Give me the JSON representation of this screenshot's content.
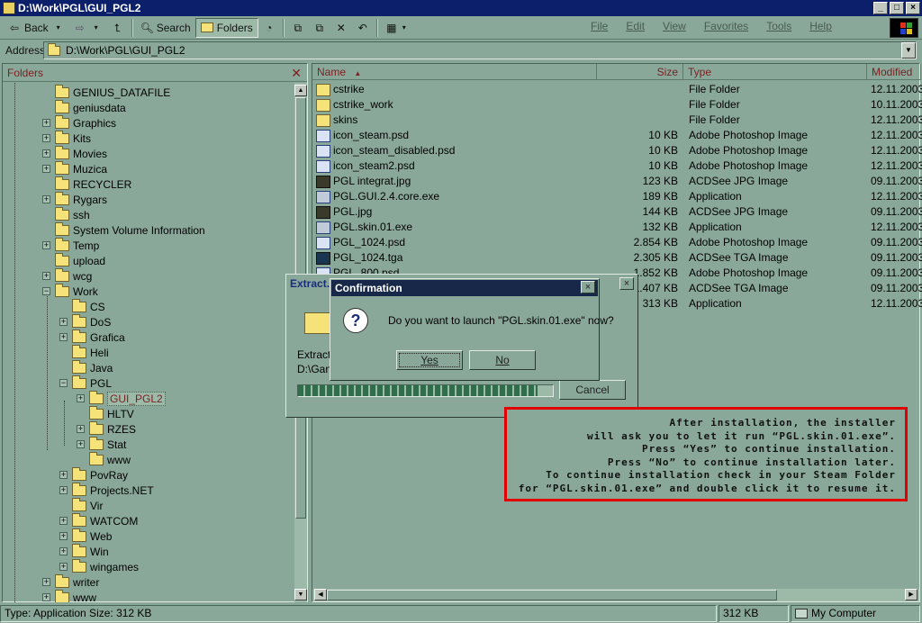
{
  "window": {
    "title": "D:\\Work\\PGL\\GUI_PGL2",
    "btn_min": "_",
    "btn_max": "□",
    "btn_close": "×"
  },
  "toolbar": {
    "back": "Back",
    "search": "Search",
    "folders": "Folders"
  },
  "menu": [
    "File",
    "Edit",
    "View",
    "Favorites",
    "Tools",
    "Help"
  ],
  "address": {
    "label": "Address",
    "value": "D:\\Work\\PGL\\GUI_PGL2"
  },
  "folders_pane": {
    "title": "Folders",
    "items": [
      {
        "label": "GENIUS_DATAFILE",
        "expander": ""
      },
      {
        "label": "geniusdata",
        "expander": ""
      },
      {
        "label": "Graphics",
        "expander": "+"
      },
      {
        "label": "Kits",
        "expander": "+"
      },
      {
        "label": "Movies",
        "expander": "+"
      },
      {
        "label": "Muzica",
        "expander": "+"
      },
      {
        "label": "RECYCLER",
        "expander": ""
      },
      {
        "label": "Rygars",
        "expander": "+"
      },
      {
        "label": "ssh",
        "expander": ""
      },
      {
        "label": "System Volume Information",
        "expander": ""
      },
      {
        "label": "Temp",
        "expander": "+"
      },
      {
        "label": "upload",
        "expander": ""
      },
      {
        "label": "wcg",
        "expander": "+"
      },
      {
        "label": "Work",
        "expander": "−"
      },
      {
        "label": "CS",
        "expander": ""
      },
      {
        "label": "DoS",
        "expander": "+"
      },
      {
        "label": "Grafica",
        "expander": "+"
      },
      {
        "label": "Heli",
        "expander": ""
      },
      {
        "label": "Java",
        "expander": ""
      },
      {
        "label": "PGL",
        "expander": "−"
      },
      {
        "label": "GUI_PGL2",
        "expander": "+"
      },
      {
        "label": "HLTV",
        "expander": ""
      },
      {
        "label": "RZES",
        "expander": "+"
      },
      {
        "label": "Stat",
        "expander": "+"
      },
      {
        "label": "www",
        "expander": ""
      },
      {
        "label": "PovRay",
        "expander": "+"
      },
      {
        "label": "Projects.NET",
        "expander": "+"
      },
      {
        "label": "Vir",
        "expander": ""
      },
      {
        "label": "WATCOM",
        "expander": "+"
      },
      {
        "label": "Web",
        "expander": "+"
      },
      {
        "label": "Win",
        "expander": "+"
      },
      {
        "label": "wingames",
        "expander": "+"
      },
      {
        "label": "writer",
        "expander": "+"
      },
      {
        "label": "www",
        "expander": "+"
      }
    ]
  },
  "files": {
    "columns": {
      "name": "Name",
      "sort_arrow": "▲",
      "size": "Size",
      "type": "Type",
      "modified": "Modified"
    },
    "rows": [
      {
        "name": "cstrike",
        "size": "",
        "type": "File Folder",
        "modified": "12.11.2003",
        "icon": "folder"
      },
      {
        "name": "cstrike_work",
        "size": "",
        "type": "File Folder",
        "modified": "10.11.2003",
        "icon": "folder"
      },
      {
        "name": "skins",
        "size": "",
        "type": "File Folder",
        "modified": "12.11.2003",
        "icon": "folder"
      },
      {
        "name": "icon_steam.psd",
        "size": "10 KB",
        "type": "Adobe Photoshop Image",
        "modified": "12.11.2003",
        "icon": "psd"
      },
      {
        "name": "icon_steam_disabled.psd",
        "size": "10 KB",
        "type": "Adobe Photoshop Image",
        "modified": "12.11.2003",
        "icon": "psd"
      },
      {
        "name": "icon_steam2.psd",
        "size": "10 KB",
        "type": "Adobe Photoshop Image",
        "modified": "12.11.2003",
        "icon": "psd"
      },
      {
        "name": "PGL integrat.jpg",
        "size": "123 KB",
        "type": "ACDSee JPG Image",
        "modified": "09.11.2003",
        "icon": "jpg"
      },
      {
        "name": "PGL.GUI.2.4.core.exe",
        "size": "189 KB",
        "type": "Application",
        "modified": "12.11.2003",
        "icon": "exe"
      },
      {
        "name": "PGL.jpg",
        "size": "144 KB",
        "type": "ACDSee JPG Image",
        "modified": "09.11.2003",
        "icon": "jpg"
      },
      {
        "name": "PGL.skin.01.exe",
        "size": "132 KB",
        "type": "Application",
        "modified": "12.11.2003",
        "icon": "exe"
      },
      {
        "name": "PGL_1024.psd",
        "size": "2.854 KB",
        "type": "Adobe Photoshop Image",
        "modified": "09.11.2003",
        "icon": "psd"
      },
      {
        "name": "PGL_1024.tga",
        "size": "2.305 KB",
        "type": "ACDSee TGA Image",
        "modified": "09.11.2003",
        "icon": "tga"
      },
      {
        "name": "PGL_800.psd",
        "size": "1.852 KB",
        "type": "Adobe Photoshop Image",
        "modified": "09.11.2003",
        "icon": "psd"
      },
      {
        "name": "",
        "size": "1.407 KB",
        "type": "ACDSee TGA Image",
        "modified": "09.11.2003",
        "icon": "tga"
      },
      {
        "name": "",
        "size": "313 KB",
        "type": "Application",
        "modified": "12.11.2003",
        "icon": "exe"
      }
    ]
  },
  "extract_dialog": {
    "title": "Extract.",
    "text1": "Extracti",
    "text2": "D:\\Gan",
    "cancel": "Cancel",
    "close": "×",
    "progress": 0.94
  },
  "confirm_dialog": {
    "title": "Confirmation",
    "question": "Do you want to launch \"PGL.skin.01.exe\" now?",
    "yes": "Yes",
    "no": "No",
    "close": "×",
    "icon": "question-icon"
  },
  "note": {
    "lines": [
      "After installation, the installer",
      "will ask you to let it run “PGL.skin.01.exe”.",
      "Press “Yes” to continue installation.",
      "Press “No” to continue installation later.",
      "To continue installation check in your Steam Folder",
      "for “PGL.skin.01.exe” and double click it to resume it."
    ],
    "border_color": "#e00000"
  },
  "status": {
    "text": "Type: Application Size: 312 KB",
    "size": "312 KB",
    "zone": "My Computer"
  }
}
